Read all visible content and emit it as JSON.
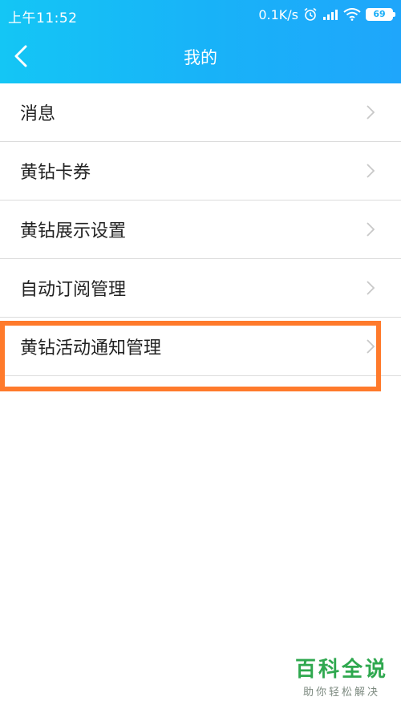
{
  "status_bar": {
    "time": "上午11:52",
    "net_speed": "0.1K/s",
    "battery_level": "69",
    "icons": [
      "alarm-icon",
      "signal-icon",
      "wifi-icon",
      "battery-icon"
    ]
  },
  "nav": {
    "title": "我的",
    "back_icon": "chevron-left-icon"
  },
  "menu": {
    "items": [
      {
        "label": "消息"
      },
      {
        "label": "黄钻卡券"
      },
      {
        "label": "黄钻展示设置"
      },
      {
        "label": "自动订阅管理"
      },
      {
        "label": "黄钻活动通知管理",
        "highlighted": true
      }
    ],
    "chevron_icon": "chevron-right-icon"
  },
  "watermark": {
    "main": "百科全说",
    "sub": "助你轻松解决"
  },
  "colors": {
    "header_gradient_start": "#14c6f5",
    "header_gradient_end": "#1fa6fb",
    "highlight": "#ff7a2b",
    "divider": "#dcdcdc",
    "watermark": "#2fa84f"
  }
}
